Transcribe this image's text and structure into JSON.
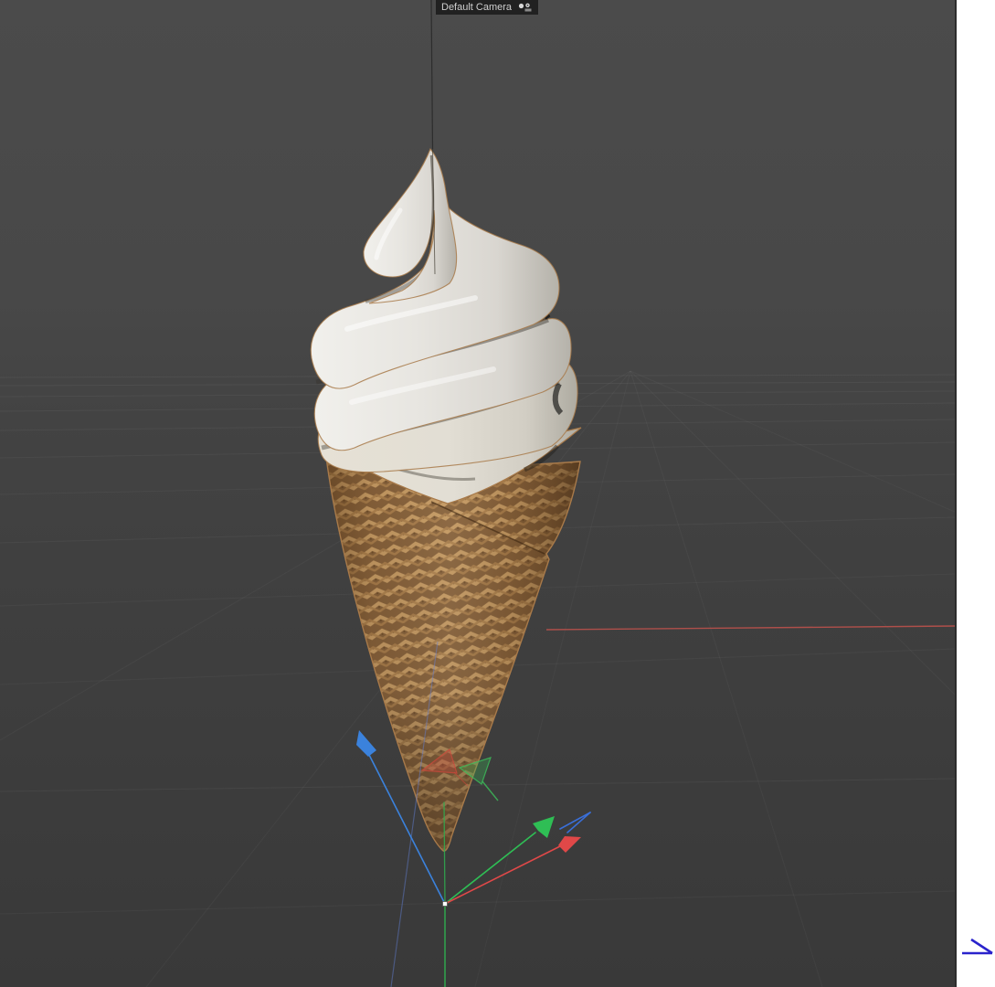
{
  "viewport": {
    "camera_label": "Default Camera",
    "label_text_color": "#cfcfcf",
    "label_bg": "rgba(24,24,24,0.82)",
    "bg_top": "#4b4b4b",
    "bg_bottom": "#383838",
    "border_color": "#2c2c2c",
    "camera_icon": "camera-object-icon"
  },
  "scene": {
    "object_name": "soft-serve ice cream in waffle cone",
    "cream_color": "#e7e5e0",
    "cream_shadow_color": "#b9b6ae",
    "cone_base_color": "#85603a",
    "cone_ridge_color": "#c59a63",
    "selection_outline_color": "#a87a4a"
  },
  "axes": {
    "x_color": "#e04848",
    "y_color": "#2fbe55",
    "z_color": "#3b82dc",
    "world_x_line_color": "#b5504b",
    "ghost_x_color": "#d7463c",
    "ghost_y_color": "#3cbe5a",
    "origin_dot_color": "#ffffff"
  },
  "page": {
    "bg": "#ffffff",
    "corner_arrow_color": "#2a23cc"
  }
}
